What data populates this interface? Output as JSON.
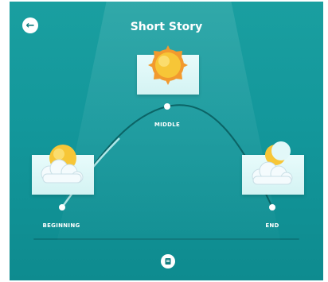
{
  "header": {
    "title": "Short Story"
  },
  "story_points": {
    "beginning": {
      "label": "BEGINNING",
      "icon": "sun-behind-cloud-icon"
    },
    "middle": {
      "label": "MIDDLE",
      "icon": "sun-icon"
    },
    "end": {
      "label": "END",
      "icon": "moon-behind-cloud-icon"
    }
  },
  "icons": {
    "back": "back-arrow-icon",
    "bottom": "book-icon"
  },
  "colors": {
    "background": "#13979b",
    "card": "#e2f8f8",
    "sun": "#f7c637"
  }
}
